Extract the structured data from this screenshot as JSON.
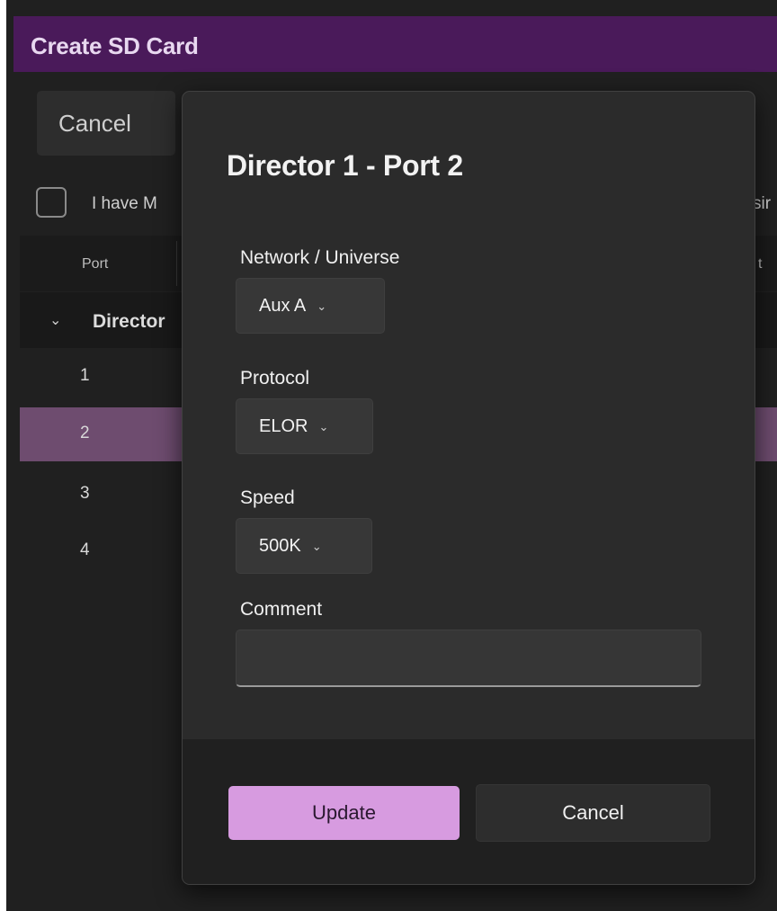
{
  "window": {
    "title": "Create SD Card"
  },
  "background": {
    "cancel_label": "Cancel",
    "checkbox_label": "I have M",
    "checkbox_label_right": "sir",
    "table": {
      "header_port": "Port",
      "header_right": "t",
      "group_label": "Director",
      "rows": [
        "1",
        "2",
        "3",
        "4"
      ],
      "selected_row": "2"
    }
  },
  "dialog": {
    "title": "Director 1 - Port 2",
    "network_label": "Network / Universe",
    "network_value": "Aux A",
    "protocol_label": "Protocol",
    "protocol_value": "ELOR",
    "speed_label": "Speed",
    "speed_value": "500K",
    "comment_label": "Comment",
    "comment_value": "",
    "update_label": "Update",
    "cancel_label": "Cancel"
  },
  "colors": {
    "accent": "#d79be0",
    "titlebar": "#4a1a5a",
    "selected_row": "#6e4c6f"
  }
}
